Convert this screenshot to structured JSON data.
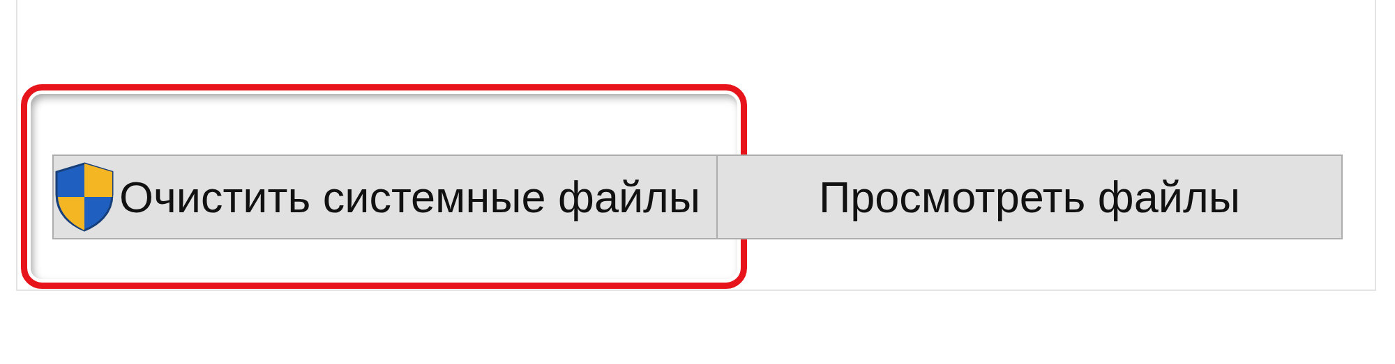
{
  "buttons": [
    {
      "label": "Очистить системные файлы",
      "kind": "admin",
      "highlighted": true
    },
    {
      "label": "Просмотреть файлы",
      "kind": "plain",
      "highlighted": false
    }
  ]
}
